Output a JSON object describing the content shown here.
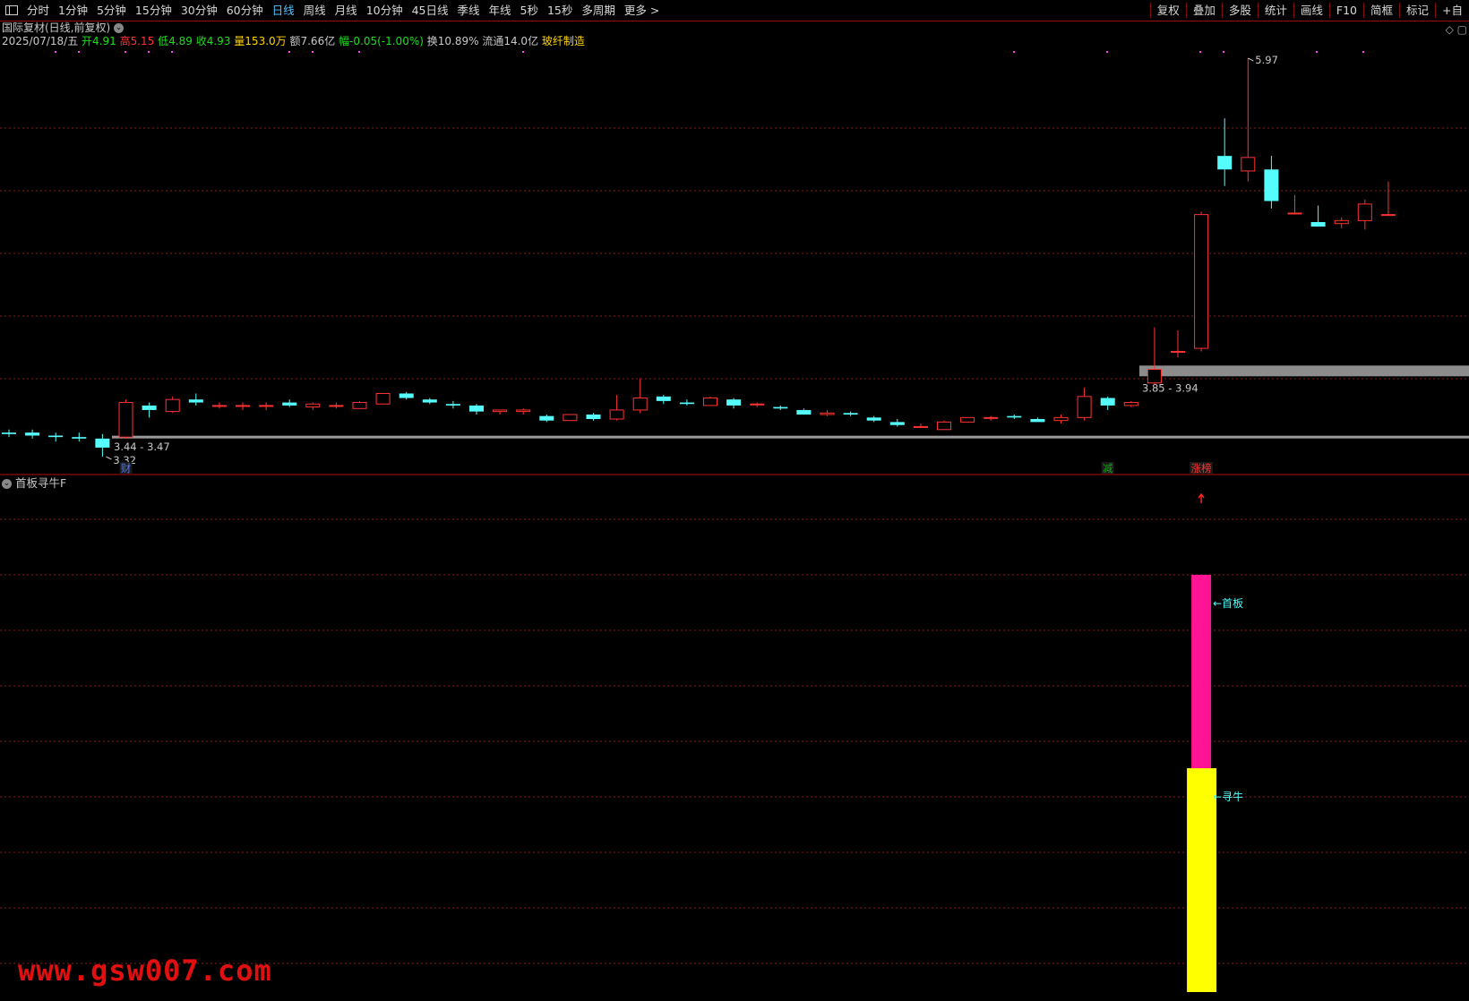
{
  "toolbar": {
    "periods": [
      "分时",
      "1分钟",
      "5分钟",
      "15分钟",
      "30分钟",
      "60分钟",
      "日线",
      "周线",
      "月线",
      "10分钟",
      "45日线",
      "季线",
      "年线",
      "5秒",
      "15秒",
      "多周期",
      "更多 >"
    ],
    "active_period": "日线",
    "right_buttons": [
      "复权",
      "叠加",
      "多股",
      "统计",
      "画线",
      "F10",
      "简框",
      "标记",
      "+自"
    ]
  },
  "stock": {
    "title": "国际复材(日线,前复权)",
    "date": "2025/07/18/五",
    "open": "开4.91",
    "high": "高5.15",
    "low": "低4.89",
    "close": "收4.93",
    "volume": "量153.0万",
    "amount": "额7.66亿",
    "change": "幅-0.05(-1.00%)",
    "turnover": "换10.89%",
    "float": "流通14.0亿",
    "sector": "玻纤制造"
  },
  "colors": {
    "up": "#ff3232",
    "down": "#54fcfc",
    "magenta": "#ff1493",
    "yellow": "#ffff00",
    "grid": "#8b1a1a"
  },
  "chart_data": {
    "type": "candlestick",
    "ylim": [
      3.25,
      6.0
    ],
    "candles": [
      [
        3.48,
        3.5,
        3.45,
        3.47
      ],
      [
        3.48,
        3.5,
        3.44,
        3.46
      ],
      [
        3.46,
        3.48,
        3.42,
        3.45
      ],
      [
        3.45,
        3.48,
        3.42,
        3.44
      ],
      [
        3.44,
        3.47,
        3.32,
        3.38
      ],
      [
        3.45,
        3.7,
        3.44,
        3.68
      ],
      [
        3.66,
        3.68,
        3.58,
        3.63
      ],
      [
        3.62,
        3.72,
        3.61,
        3.7
      ],
      [
        3.7,
        3.74,
        3.66,
        3.68
      ],
      [
        3.66,
        3.68,
        3.64,
        3.66
      ],
      [
        3.66,
        3.68,
        3.63,
        3.66
      ],
      [
        3.66,
        3.68,
        3.63,
        3.66
      ],
      [
        3.68,
        3.7,
        3.65,
        3.66
      ],
      [
        3.65,
        3.68,
        3.63,
        3.67
      ],
      [
        3.66,
        3.68,
        3.64,
        3.66
      ],
      [
        3.64,
        3.69,
        3.64,
        3.68
      ],
      [
        3.67,
        3.74,
        3.67,
        3.74
      ],
      [
        3.74,
        3.75,
        3.7,
        3.71
      ],
      [
        3.7,
        3.71,
        3.67,
        3.68
      ],
      [
        3.67,
        3.69,
        3.64,
        3.66
      ],
      [
        3.66,
        3.67,
        3.6,
        3.62
      ],
      [
        3.62,
        3.63,
        3.6,
        3.63
      ],
      [
        3.62,
        3.64,
        3.6,
        3.63
      ],
      [
        3.59,
        3.6,
        3.55,
        3.56
      ],
      [
        3.56,
        3.6,
        3.56,
        3.6
      ],
      [
        3.6,
        3.61,
        3.56,
        3.57
      ],
      [
        3.57,
        3.73,
        3.56,
        3.63
      ],
      [
        3.63,
        3.84,
        3.61,
        3.71
      ],
      [
        3.72,
        3.73,
        3.67,
        3.69
      ],
      [
        3.68,
        3.7,
        3.66,
        3.67
      ],
      [
        3.66,
        3.72,
        3.66,
        3.71
      ],
      [
        3.7,
        3.71,
        3.64,
        3.66
      ],
      [
        3.67,
        3.68,
        3.65,
        3.67
      ],
      [
        3.65,
        3.66,
        3.63,
        3.64
      ],
      [
        3.63,
        3.64,
        3.6,
        3.6
      ],
      [
        3.6,
        3.63,
        3.59,
        3.61
      ],
      [
        3.61,
        3.62,
        3.59,
        3.6
      ],
      [
        3.58,
        3.59,
        3.55,
        3.56
      ],
      [
        3.55,
        3.57,
        3.52,
        3.53
      ],
      [
        3.52,
        3.54,
        3.51,
        3.52
      ],
      [
        3.5,
        3.56,
        3.5,
        3.55
      ],
      [
        3.55,
        3.58,
        3.55,
        3.58
      ],
      [
        3.58,
        3.59,
        3.56,
        3.58
      ],
      [
        3.59,
        3.6,
        3.57,
        3.58
      ],
      [
        3.57,
        3.58,
        3.55,
        3.55
      ],
      [
        3.56,
        3.6,
        3.54,
        3.58
      ],
      [
        3.58,
        3.78,
        3.56,
        3.72
      ],
      [
        3.71,
        3.72,
        3.63,
        3.66
      ],
      [
        3.66,
        3.69,
        3.65,
        3.68
      ],
      [
        3.81,
        4.18,
        3.8,
        3.9
      ],
      [
        4.02,
        4.16,
        3.98,
        4.02
      ],
      [
        4.04,
        4.95,
        4.02,
        4.93
      ],
      [
        5.32,
        5.57,
        5.12,
        5.23
      ],
      [
        5.22,
        5.97,
        5.15,
        5.31
      ],
      [
        5.23,
        5.32,
        4.97,
        5.02
      ],
      [
        4.94,
        5.06,
        4.93,
        4.94
      ],
      [
        4.88,
        4.99,
        4.85,
        4.85
      ],
      [
        4.87,
        4.91,
        4.84,
        4.89
      ],
      [
        4.89,
        5.03,
        4.83,
        5.0
      ],
      [
        4.93,
        5.15,
        4.92,
        4.93
      ]
    ],
    "price_high_label": "5.97",
    "price_low_label": "3.32",
    "zone_low": {
      "label": "3.44 - 3.47",
      "level": 3.45
    },
    "zone_high": {
      "label": "3.85 - 3.94",
      "level": 3.89
    },
    "markers": [
      {
        "index": 5,
        "text": "财",
        "color": "#4d7dff"
      },
      {
        "index": 47,
        "text": "减",
        "color": "#19a019"
      },
      {
        "index": 51,
        "text": "涨榜",
        "color": "#ff3232"
      }
    ]
  },
  "indicator": {
    "title": "首板寻牛F",
    "label_top": "←首板",
    "label_bottom": "←寻牛"
  },
  "watermark": "www.gsw007.com",
  "icons": {
    "menu": "menu-icon",
    "collapse": "chevron-down-icon",
    "right_a": "diamond-icon",
    "right_b": "square-icon"
  }
}
